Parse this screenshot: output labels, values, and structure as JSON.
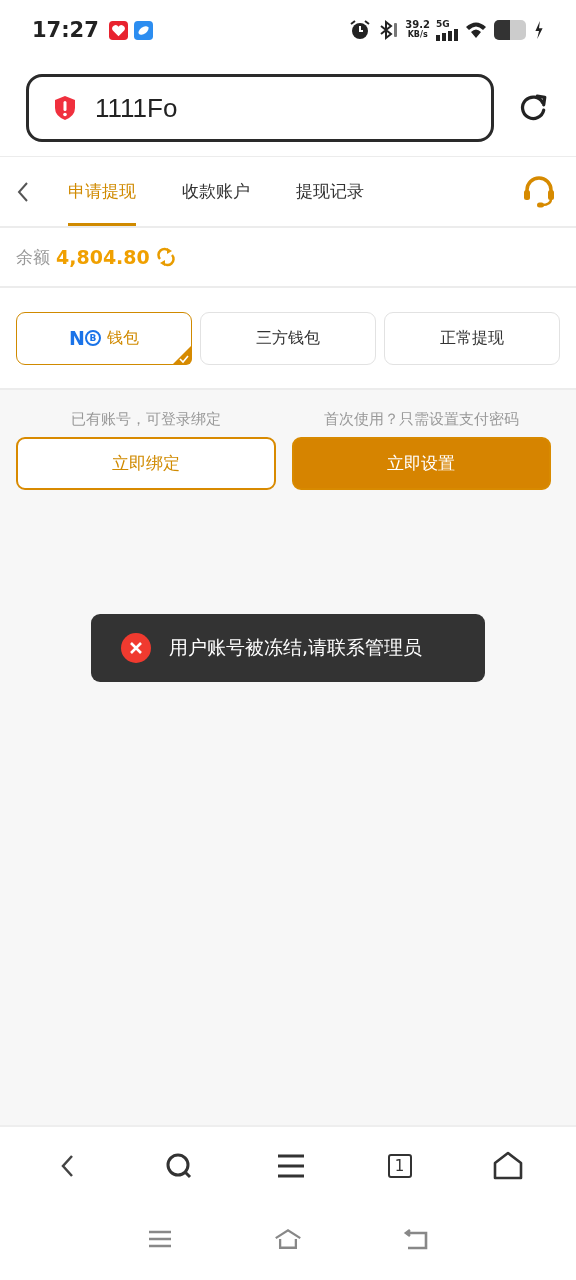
{
  "status_bar": {
    "time": "17:27",
    "speed": "39.2",
    "speed_unit": "KB/s",
    "network": "5G"
  },
  "address_bar": {
    "value": "1111Fo"
  },
  "tabs": [
    {
      "label": "申请提现",
      "selected": true
    },
    {
      "label": "收款账户",
      "selected": false
    },
    {
      "label": "提现记录",
      "selected": false
    }
  ],
  "balance": {
    "label": "余额",
    "amount": "4,804.80"
  },
  "wallet_options": [
    {
      "kind": "logo",
      "logo": "N",
      "logo_mark": "B",
      "label": "钱包",
      "selected": true
    },
    {
      "kind": "text",
      "label": "三方钱包",
      "selected": false
    },
    {
      "kind": "text",
      "label": "正常提现",
      "selected": false
    }
  ],
  "actions": [
    {
      "hint": "已有账号，可登录绑定",
      "label": "立即绑定",
      "kind": "outline"
    },
    {
      "hint": "首次使用？只需设置支付密码",
      "label": "立即设置",
      "kind": "filled"
    }
  ],
  "toast": {
    "message": "用户账号被冻结,请联系管理员"
  },
  "browser_toolbar": {
    "tab_count": "1"
  }
}
